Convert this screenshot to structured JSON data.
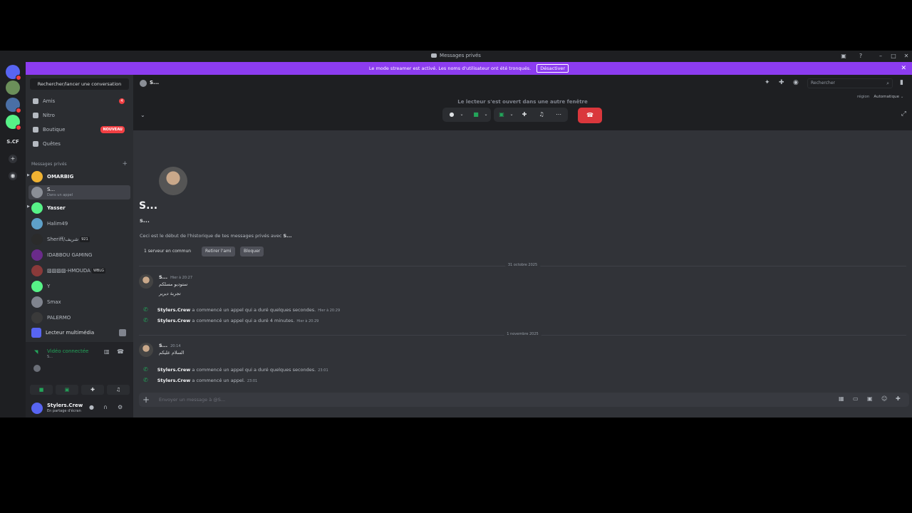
{
  "window": {
    "title": "Messages privés"
  },
  "rail": {
    "server_label": "S.CF"
  },
  "banner": {
    "text": "Le mode streamer est activé. Les noms d'utilisateur ont été tronqués.",
    "button": "Désactiver"
  },
  "sidebar": {
    "search": "Rechercher/lancer une conversation",
    "nav": [
      {
        "label": "Amis",
        "badge": "4"
      },
      {
        "label": "Nitro"
      },
      {
        "label": "Boutique",
        "badge": "NOUVEAU"
      },
      {
        "label": "Quêtes"
      }
    ],
    "dm_header": "Messages privés",
    "dms": [
      {
        "name": "OMARBIG",
        "color": "#f0b232"
      },
      {
        "name": "S...",
        "sub": "Dans un appel",
        "color": "#8a8e96"
      },
      {
        "name": "Yasser",
        "color": "#57f287"
      },
      {
        "name": "Halim49",
        "color": "#5ea0c8"
      },
      {
        "name": "Sheriff/شريف",
        "tag": "921",
        "color": "#2b2b2b"
      },
      {
        "name": "IDABBOU GAMING",
        "color": "#6a2b8a"
      },
      {
        "name": "▨▨▨▨-HMOUDA",
        "tag": "WBLG",
        "color": "#8a3a3a"
      },
      {
        "name": "Y",
        "color": "#57f287"
      },
      {
        "name": "Smax",
        "color": "#80848e"
      },
      {
        "name": "PALERMO",
        "color": "#3a3a3a"
      }
    ],
    "media_player": "Lecteur multimédia",
    "voice": {
      "status": "Vidéo connectée",
      "channel": "S..."
    },
    "user": {
      "name": "Stylers.Crew",
      "status": "En partage d'écran"
    }
  },
  "main": {
    "channel_name": "S...",
    "search_placeholder": "Rechercher",
    "region_label": "région",
    "region_value": "Automatique",
    "popout_text": "Le lecteur s'est ouvert dans une autre fenêtre",
    "profile": {
      "name": "S...",
      "tag": "s...",
      "intro": "Ceci est le début de l'historique de tes messages privés avec",
      "intro_name": "S...",
      "mutual": "1 serveur en commun",
      "remove_friend": "Retirer l'ami",
      "block": "Bloquer"
    },
    "dividers": [
      "31 octobre 2025",
      "1 novembre 2025"
    ],
    "messages": [
      {
        "author": "S...",
        "time": "Hier à 20:27",
        "lines": [
          "ستوديو مسلكم",
          "تجربة ديرير"
        ]
      },
      {
        "author": "S...",
        "time": "20:14",
        "lines": [
          "السلام عليكم"
        ]
      }
    ],
    "calls": [
      {
        "who": "Stylers.Crew",
        "text": "a commencé un appel qui a duré quelques secondes.",
        "time": "Hier à 20:29"
      },
      {
        "who": "Stylers.Crew",
        "text": "a commencé un appel qui a duré 4 minutes.",
        "time": "Hier à 20:29"
      },
      {
        "who": "Stylers.Crew",
        "text": "a commencé un appel qui a duré quelques secondes.",
        "time": "23:01"
      },
      {
        "who": "Stylers.Crew",
        "text": "a commencé un appel.",
        "time": "23:01"
      }
    ],
    "composer_placeholder": "Envoyer un message à @S..."
  },
  "colors": {
    "accent": "#5865f2",
    "banner": "#8c3cf0",
    "danger": "#da373c",
    "online": "#23a55a"
  }
}
